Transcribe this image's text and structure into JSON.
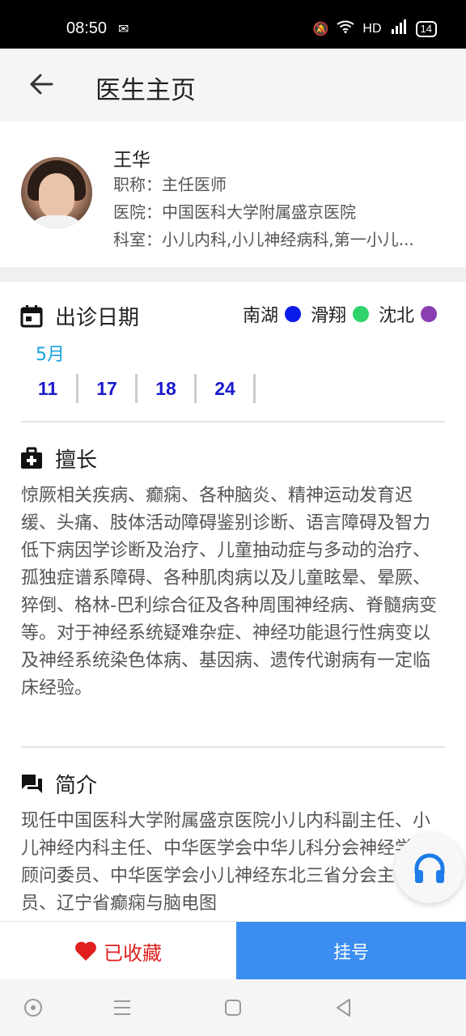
{
  "status_bar": {
    "time": "08:50",
    "network": "HD",
    "signal": "5G",
    "battery": "14"
  },
  "app_bar": {
    "title": "医生主页",
    "back_icon": "arrow-left-icon"
  },
  "doctor": {
    "name": "王华",
    "title_line": "职称：主任医师",
    "hospital_line": "医院：中国医科大学附属盛京医院",
    "department_line": "科室：小儿内科,小儿神经病科,第一小儿..."
  },
  "schedule": {
    "heading": "出诊日期",
    "icon": "calendar-icon",
    "legend": [
      {
        "label": "南湖",
        "color": "#0a1ae8"
      },
      {
        "label": "滑翔",
        "color": "#2ed36a"
      },
      {
        "label": "沈北",
        "color": "#8a3fb0"
      }
    ],
    "month": "5月",
    "dates": [
      "11",
      "17",
      "18",
      "24"
    ]
  },
  "specialty": {
    "heading": "擅长",
    "icon": "medical-kit-icon",
    "text": "惊厥相关疾病、癫痫、各种脑炎、精神运动发育迟缓、头痛、肢体活动障碍鉴别诊断、语言障碍及智力低下病因学诊断及治疗、儿童抽动症与多动的治疗、孤独症谱系障碍、各种肌肉病以及儿童眩晕、晕厥、猝倒、格林-巴利综合征及各种周围神经病、脊髓病变等。对于神经系统疑难杂症、神经功能退行性病变以及神经系统染色体病、基因病、遗传代谢病有一定临床经验。"
  },
  "intro": {
    "heading": "简介",
    "icon": "chat-bubbles-icon",
    "text": "现任中国医科大学附属盛京医院小儿内科副主任、小儿神经内科主任、中华医学会中华儿科分会神经学组顾问委员、中华医学会小儿神经东北三省分会主任委员、辽宁省癫痫与脑电图"
  },
  "bottom": {
    "favorite_label": "已收藏",
    "register_label": "挂号",
    "fav_color": "#e02020",
    "register_color": "#3b8ef0"
  }
}
